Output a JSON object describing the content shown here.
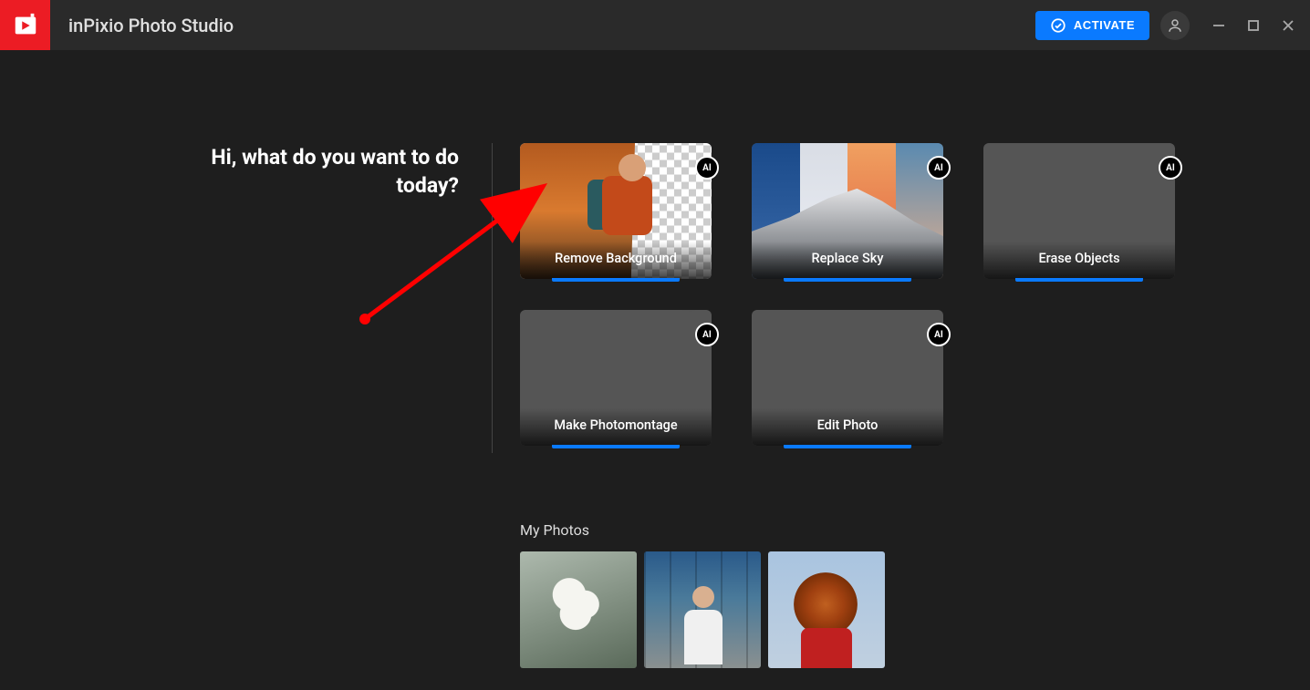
{
  "header": {
    "app_title": "inPixio Photo Studio",
    "activate_label": "ACTIVATE"
  },
  "greeting": {
    "line1": "Hi, what do you want to do",
    "line2": "today?"
  },
  "cards": {
    "remove_bg": {
      "label": "Remove Background",
      "badge": "AI"
    },
    "replace_sky": {
      "label": "Replace Sky",
      "badge": "AI"
    },
    "erase_objects": {
      "label": "Erase Objects",
      "badge": "AI"
    },
    "photomontage": {
      "label": "Make Photomontage",
      "badge": "AI"
    },
    "edit_photo": {
      "label": "Edit Photo",
      "badge": "AI"
    }
  },
  "my_photos": {
    "title": "My Photos"
  },
  "colors": {
    "accent": "#0a7aff",
    "brand": "#ec1c24",
    "bg": "#1e1e1e",
    "header_bg": "#2a2a2a"
  }
}
